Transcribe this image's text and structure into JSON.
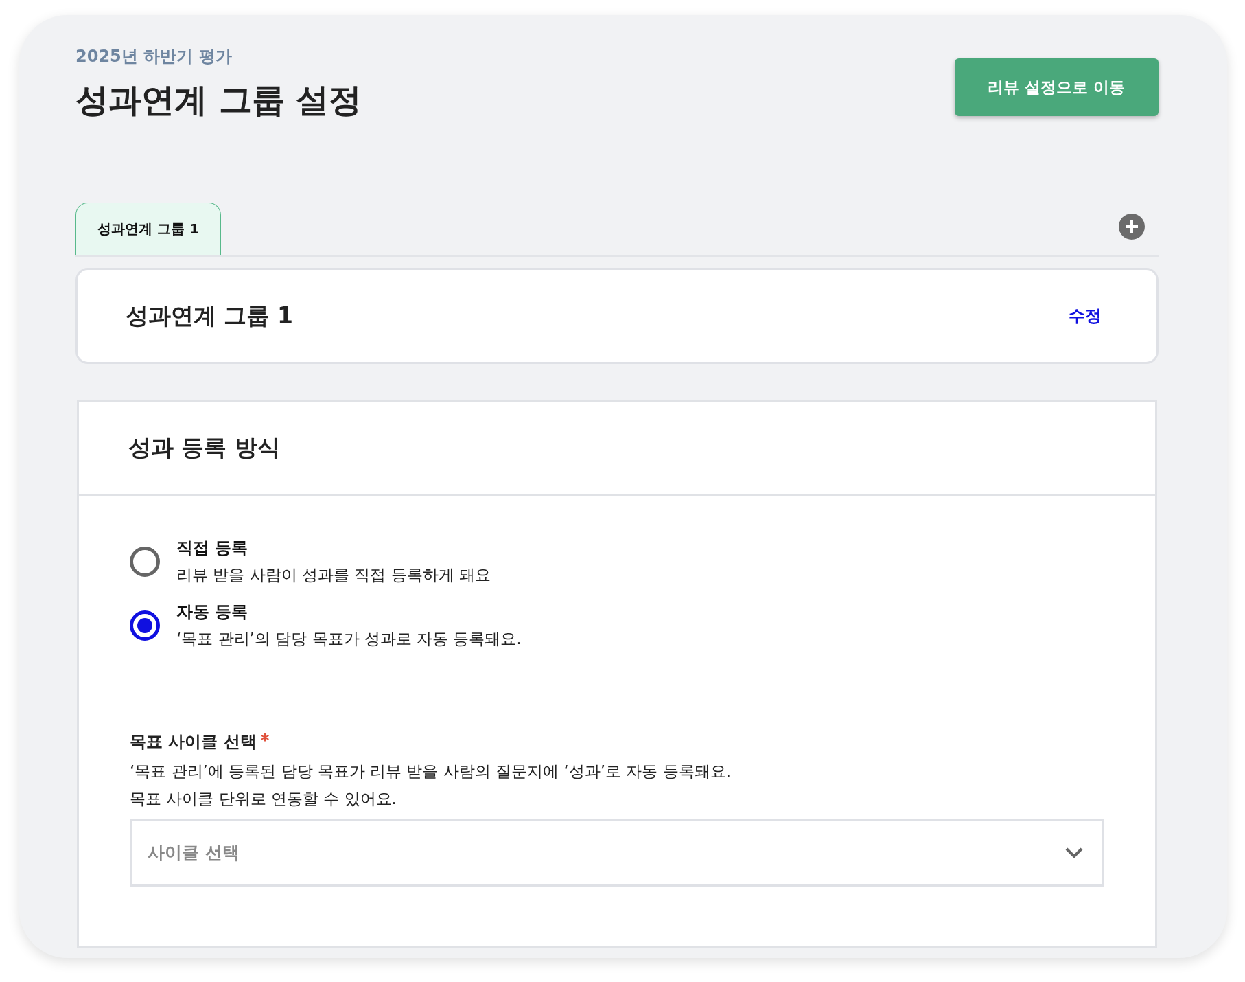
{
  "header": {
    "subtitle": "2025년 하반기 평가",
    "title": "성과연계 그룹 설정",
    "action_button": "리뷰 설정으로 이동"
  },
  "tabs": [
    {
      "label": "성과연계 그룹 1",
      "selected": true
    }
  ],
  "group_card": {
    "name": "성과연계 그룹 1",
    "edit_link": "수정"
  },
  "section": {
    "title": "성과 등록 방식",
    "options": [
      {
        "label": "직접 등록",
        "description": "리뷰 받을 사람이 성과를 직접 등록하게 돼요",
        "selected": false
      },
      {
        "label": "자동 등록",
        "description": "‘목표 관리’의 담당 목표가 성과로 자동 등록돼요.",
        "selected": true
      }
    ],
    "field": {
      "label": "목표 사이클 선택",
      "required_mark": "*",
      "help_lines": [
        "‘목표 관리’에 등록된 담당 목표가 리뷰 받을 사람의 질문지에 ‘성과’로 자동 등록돼요.",
        "목표 사이클 단위로 연동할 수 있어요."
      ],
      "placeholder": "사이클 선택"
    }
  }
}
